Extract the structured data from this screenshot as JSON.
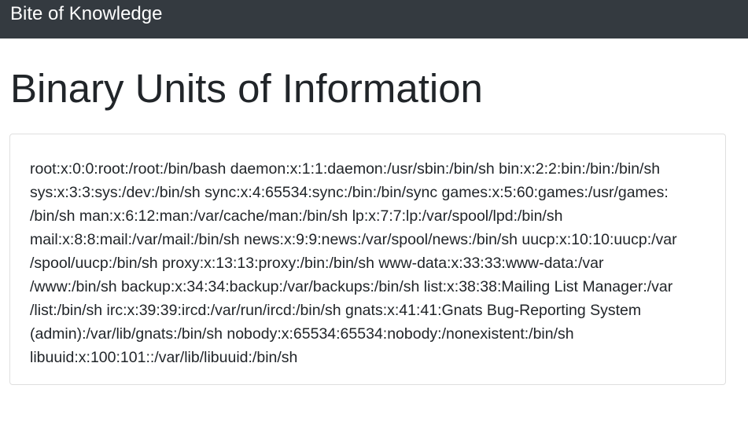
{
  "navbar": {
    "brand": "Bite of Knowledge"
  },
  "main": {
    "title": "Binary Units of Information",
    "card": {
      "lines": [
        "root:x:0:0:root:/root:/bin/bash daemon:x:1:1:daemon:/usr/sbin:/bin/sh bin:x:2:2:bin:/bin:/bin/sh",
        "sys:x:3:3:sys:/dev:/bin/sh sync:x:4:65534:sync:/bin:/bin/sync games:x:5:60:games:/usr/games:",
        "/bin/sh man:x:6:12:man:/var/cache/man:/bin/sh lp:x:7:7:lp:/var/spool/lpd:/bin/sh",
        "mail:x:8:8:mail:/var/mail:/bin/sh news:x:9:9:news:/var/spool/news:/bin/sh uucp:x:10:10:uucp:/var",
        "/spool/uucp:/bin/sh proxy:x:13:13:proxy:/bin:/bin/sh www-data:x:33:33:www-data:/var",
        "/www:/bin/sh backup:x:34:34:backup:/var/backups:/bin/sh list:x:38:38:Mailing List Manager:/var",
        "/list:/bin/sh irc:x:39:39:ircd:/var/run/ircd:/bin/sh gnats:x:41:41:Gnats Bug-Reporting System",
        "(admin):/var/lib/gnats:/bin/sh nobody:x:65534:65534:nobody:/nonexistent:/bin/sh",
        "libuuid:x:100:101::/var/lib/libuuid:/bin/sh"
      ]
    }
  }
}
